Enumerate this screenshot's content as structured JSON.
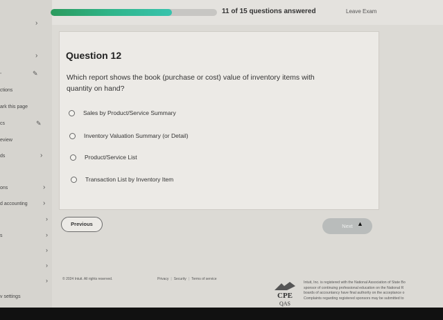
{
  "header": {
    "progress_percent": 73,
    "progress_text": "11 of 15 questions answered",
    "leave_exam": "Leave Exam"
  },
  "sidebar": {
    "items": [
      {
        "label": "ctions"
      },
      {
        "label": "ark this page"
      },
      {
        "label": "cs"
      },
      {
        "label": "eview"
      },
      {
        "label": "ds"
      },
      {
        "label": "ons"
      },
      {
        "label": "d accounting"
      },
      {
        "label": "s"
      },
      {
        "label": "v settings"
      }
    ]
  },
  "question": {
    "title": "Question 12",
    "text": "Which report shows the book (purchase or cost) value of inventory items with quantity on hand?",
    "options": [
      {
        "label": "Sales by Product/Service Summary"
      },
      {
        "label": "Inventory Valuation Summary (or Detail)"
      },
      {
        "label": "Product/Service List"
      },
      {
        "label": "Transaction List by Inventory Item"
      }
    ]
  },
  "nav": {
    "previous": "Previous",
    "next": "Next"
  },
  "footer": {
    "copyright": "© 2024 Intuit. All rights reserved.",
    "links": [
      "Privacy",
      "Security",
      "Terms of service"
    ],
    "logo_text": "CPE",
    "logo_sub": "QAS",
    "disclaimer_lines": [
      "Intuit, Inc. is registered with the National Association of State Bo",
      "sponsor of continuing professional education on the National R",
      "boards of accountancy have final authority on the acceptance o",
      "Complaints regarding registered sponsors may be submitted to"
    ]
  },
  "colors": {
    "progress_fill": "#2fb58a",
    "next_disabled": "#b9bcbb"
  }
}
